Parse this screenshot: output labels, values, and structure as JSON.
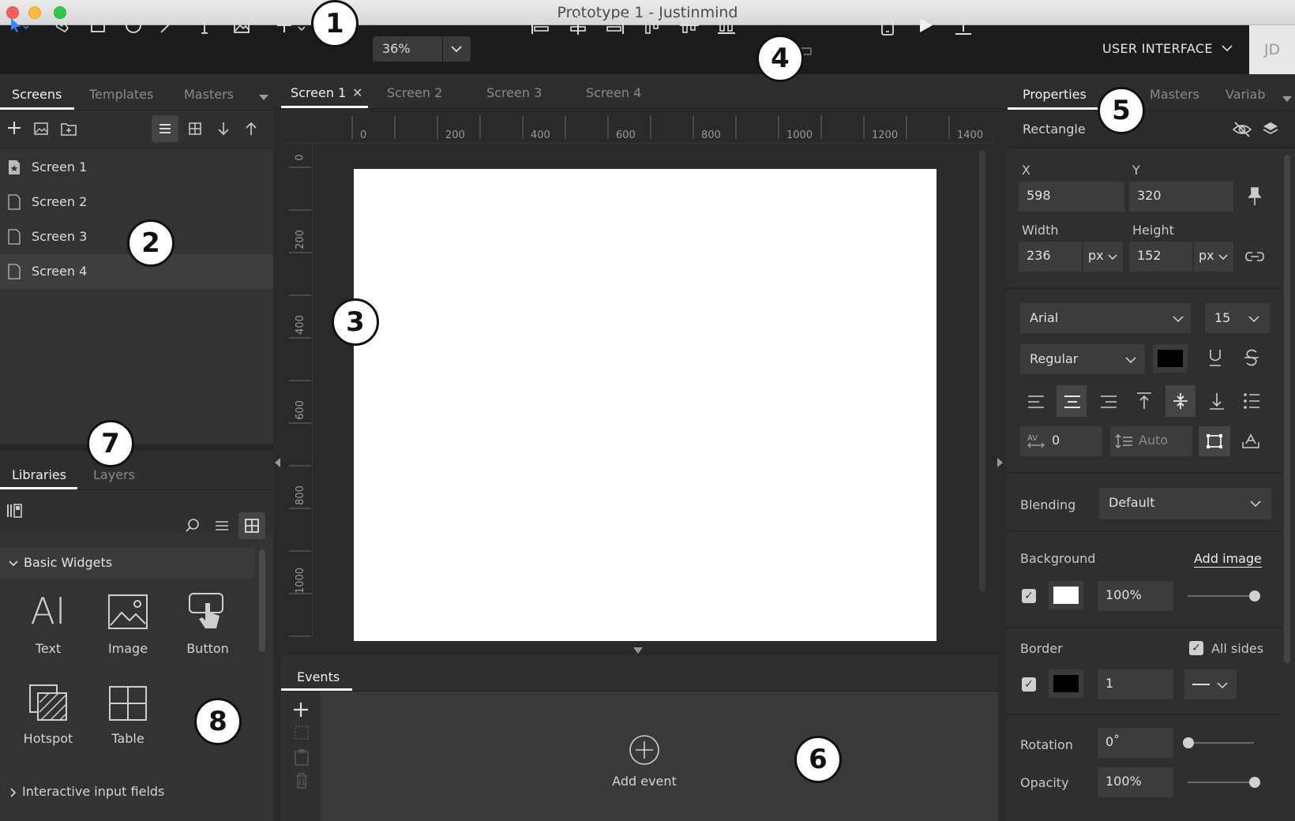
{
  "window": {
    "title": "Prototype 1 - Justinmind"
  },
  "toolbar": {
    "zoom": "36%",
    "mode": "USER INTERFACE",
    "user_initials": "JD",
    "tools": [
      "select-tool-icon",
      "pen-tool-icon",
      "rectangle-tool-icon",
      "ellipse-tool-icon",
      "line-tool-icon",
      "text-tool-icon",
      "image-tool-icon",
      "add-icon"
    ]
  },
  "badges": [
    "1",
    "2",
    "3",
    "4",
    "5",
    "6",
    "7",
    "8"
  ],
  "screens_panel": {
    "tabs": [
      "Screens",
      "Templates",
      "Masters"
    ],
    "items": [
      "Screen 1",
      "Screen 2",
      "Screen 3",
      "Screen 4"
    ]
  },
  "libraries_panel": {
    "tabs": [
      "Libraries",
      "Layers"
    ],
    "group_open": "Basic Widgets",
    "widgets": [
      "Text",
      "Image",
      "Button",
      "Hotspot",
      "Table"
    ],
    "text_widget_glyph": "AI",
    "group_closed": "Interactive input fields"
  },
  "canvas": {
    "tabs": [
      "Screen 1",
      "Screen 2",
      "Screen 3",
      "Screen 4"
    ],
    "ruler_x": [
      "0",
      "200",
      "400",
      "600",
      "800",
      "1000",
      "1200",
      "1400"
    ],
    "ruler_y": [
      "0",
      "200",
      "400",
      "600",
      "800",
      "1000"
    ]
  },
  "events": {
    "tab": "Events",
    "add_label": "Add event"
  },
  "properties": {
    "tabs": [
      "Properties",
      "Masters",
      "Variab"
    ],
    "element_type": "Rectangle",
    "x_label": "X",
    "x": "598",
    "y_label": "Y",
    "y": "320",
    "width_label": "Width",
    "width": "236",
    "width_unit": "px",
    "height_label": "Height",
    "height": "152",
    "height_unit": "px",
    "font": "Arial",
    "font_size": "15",
    "font_weight": "Regular",
    "letter_spacing": "0",
    "line_height": "Auto",
    "blending_label": "Blending",
    "blending": "Default",
    "background_label": "Background",
    "add_image": "Add image",
    "bg_opacity": "100%",
    "border_label": "Border",
    "all_sides": "All sides",
    "border_width": "1",
    "rotation_label": "Rotation",
    "rotation": "0˚",
    "opacity_label": "Opacity",
    "opacity": "100%",
    "text_color": "#000000",
    "bg_color": "#ffffff",
    "border_color": "#000000"
  }
}
